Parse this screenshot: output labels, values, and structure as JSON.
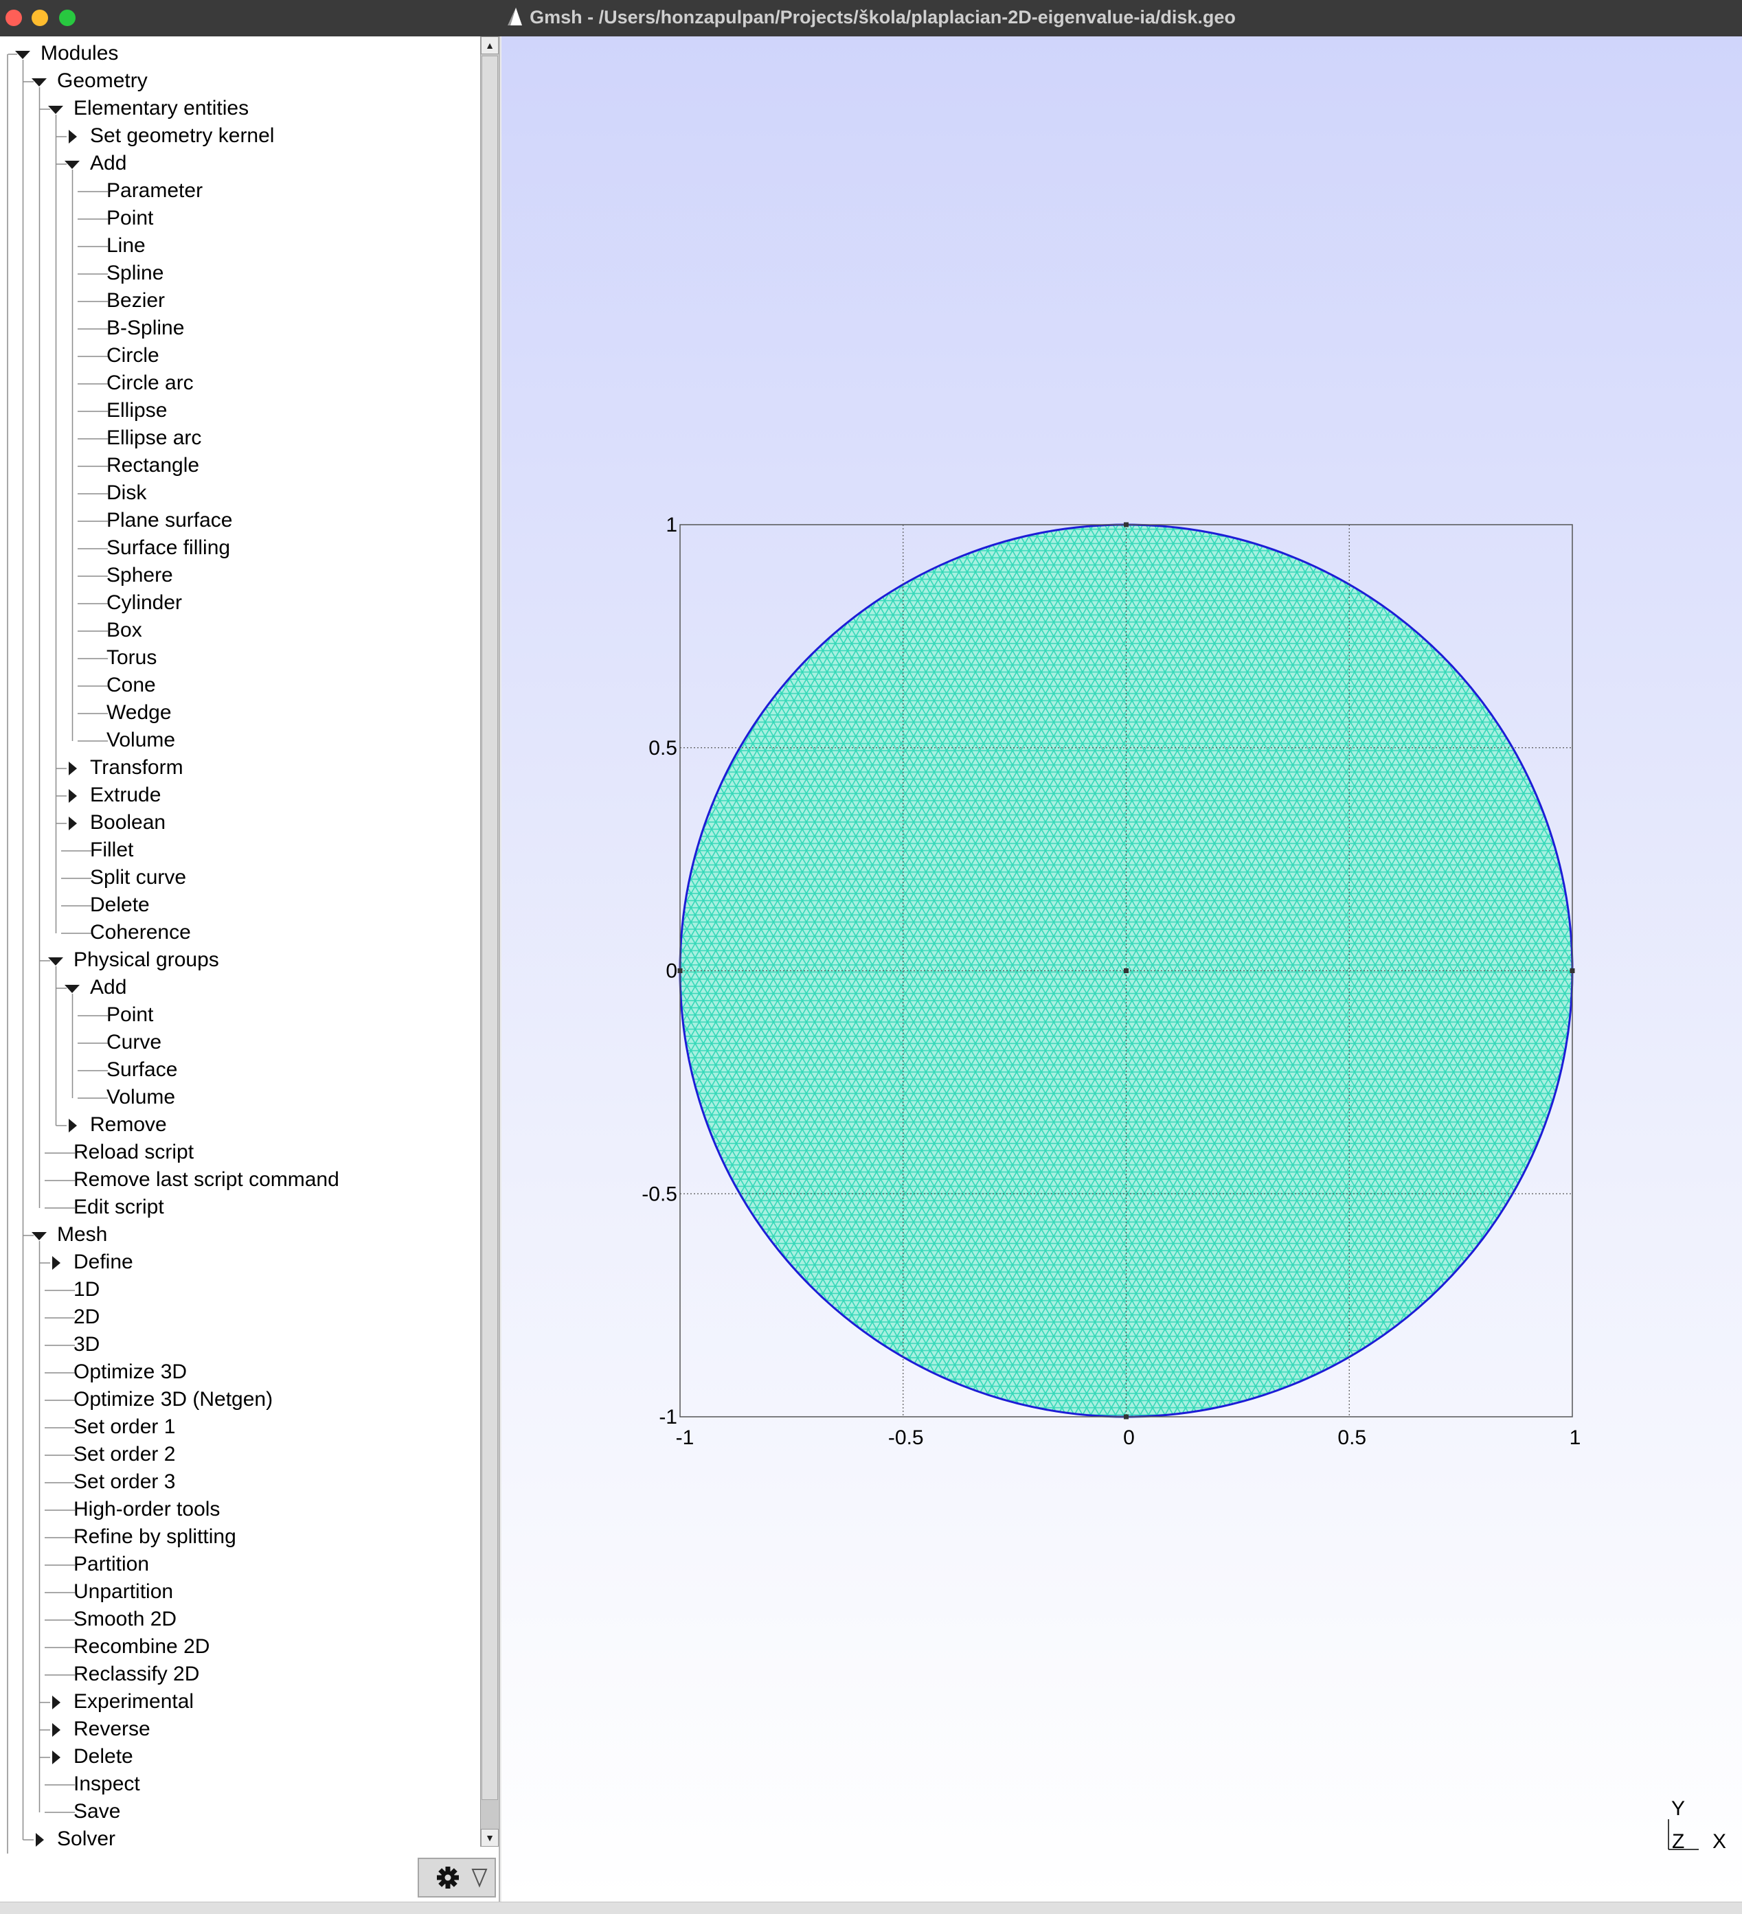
{
  "window": {
    "title": "Gmsh - /Users/honzapulpan/Projects/škola/plaplacian-2D-eigenvalue-ia/disk.geo",
    "traffic_lights": [
      "#ff5f57",
      "#febc2e",
      "#28c840"
    ]
  },
  "tree": [
    {
      "label": "Modules",
      "depth": 0,
      "toggle": "open"
    },
    {
      "label": "Geometry",
      "depth": 1,
      "toggle": "open"
    },
    {
      "label": "Elementary entities",
      "depth": 2,
      "toggle": "open"
    },
    {
      "label": "Set geometry kernel",
      "depth": 3,
      "toggle": "closed"
    },
    {
      "label": "Add",
      "depth": 3,
      "toggle": "open"
    },
    {
      "label": "Parameter",
      "depth": 4,
      "toggle": "leaf"
    },
    {
      "label": "Point",
      "depth": 4,
      "toggle": "leaf"
    },
    {
      "label": "Line",
      "depth": 4,
      "toggle": "leaf"
    },
    {
      "label": "Spline",
      "depth": 4,
      "toggle": "leaf"
    },
    {
      "label": "Bezier",
      "depth": 4,
      "toggle": "leaf"
    },
    {
      "label": "B-Spline",
      "depth": 4,
      "toggle": "leaf"
    },
    {
      "label": "Circle",
      "depth": 4,
      "toggle": "leaf"
    },
    {
      "label": "Circle arc",
      "depth": 4,
      "toggle": "leaf"
    },
    {
      "label": "Ellipse",
      "depth": 4,
      "toggle": "leaf"
    },
    {
      "label": "Ellipse arc",
      "depth": 4,
      "toggle": "leaf"
    },
    {
      "label": "Rectangle",
      "depth": 4,
      "toggle": "leaf"
    },
    {
      "label": "Disk",
      "depth": 4,
      "toggle": "leaf"
    },
    {
      "label": "Plane surface",
      "depth": 4,
      "toggle": "leaf"
    },
    {
      "label": "Surface filling",
      "depth": 4,
      "toggle": "leaf"
    },
    {
      "label": "Sphere",
      "depth": 4,
      "toggle": "leaf"
    },
    {
      "label": "Cylinder",
      "depth": 4,
      "toggle": "leaf"
    },
    {
      "label": "Box",
      "depth": 4,
      "toggle": "leaf"
    },
    {
      "label": "Torus",
      "depth": 4,
      "toggle": "leaf"
    },
    {
      "label": "Cone",
      "depth": 4,
      "toggle": "leaf"
    },
    {
      "label": "Wedge",
      "depth": 4,
      "toggle": "leaf"
    },
    {
      "label": "Volume",
      "depth": 4,
      "toggle": "leaf"
    },
    {
      "label": "Transform",
      "depth": 3,
      "toggle": "closed"
    },
    {
      "label": "Extrude",
      "depth": 3,
      "toggle": "closed"
    },
    {
      "label": "Boolean",
      "depth": 3,
      "toggle": "closed"
    },
    {
      "label": "Fillet",
      "depth": 3,
      "toggle": "leaf"
    },
    {
      "label": "Split curve",
      "depth": 3,
      "toggle": "leaf"
    },
    {
      "label": "Delete",
      "depth": 3,
      "toggle": "leaf"
    },
    {
      "label": "Coherence",
      "depth": 3,
      "toggle": "leaf"
    },
    {
      "label": "Physical groups",
      "depth": 2,
      "toggle": "open"
    },
    {
      "label": "Add",
      "depth": 3,
      "toggle": "open"
    },
    {
      "label": "Point",
      "depth": 4,
      "toggle": "leaf"
    },
    {
      "label": "Curve",
      "depth": 4,
      "toggle": "leaf"
    },
    {
      "label": "Surface",
      "depth": 4,
      "toggle": "leaf"
    },
    {
      "label": "Volume",
      "depth": 4,
      "toggle": "leaf"
    },
    {
      "label": "Remove",
      "depth": 3,
      "toggle": "closed"
    },
    {
      "label": "Reload script",
      "depth": 2,
      "toggle": "leaf"
    },
    {
      "label": "Remove last script command",
      "depth": 2,
      "toggle": "leaf"
    },
    {
      "label": "Edit script",
      "depth": 2,
      "toggle": "leaf"
    },
    {
      "label": "Mesh",
      "depth": 1,
      "toggle": "open"
    },
    {
      "label": "Define",
      "depth": 2,
      "toggle": "closed"
    },
    {
      "label": "1D",
      "depth": 2,
      "toggle": "leaf"
    },
    {
      "label": "2D",
      "depth": 2,
      "toggle": "leaf"
    },
    {
      "label": "3D",
      "depth": 2,
      "toggle": "leaf"
    },
    {
      "label": "Optimize 3D",
      "depth": 2,
      "toggle": "leaf"
    },
    {
      "label": "Optimize 3D (Netgen)",
      "depth": 2,
      "toggle": "leaf"
    },
    {
      "label": "Set order 1",
      "depth": 2,
      "toggle": "leaf"
    },
    {
      "label": "Set order 2",
      "depth": 2,
      "toggle": "leaf"
    },
    {
      "label": "Set order 3",
      "depth": 2,
      "toggle": "leaf"
    },
    {
      "label": "High-order tools",
      "depth": 2,
      "toggle": "leaf"
    },
    {
      "label": "Refine by splitting",
      "depth": 2,
      "toggle": "leaf"
    },
    {
      "label": "Partition",
      "depth": 2,
      "toggle": "leaf"
    },
    {
      "label": "Unpartition",
      "depth": 2,
      "toggle": "leaf"
    },
    {
      "label": "Smooth 2D",
      "depth": 2,
      "toggle": "leaf"
    },
    {
      "label": "Recombine 2D",
      "depth": 2,
      "toggle": "leaf"
    },
    {
      "label": "Reclassify 2D",
      "depth": 2,
      "toggle": "leaf"
    },
    {
      "label": "Experimental",
      "depth": 2,
      "toggle": "closed"
    },
    {
      "label": "Reverse",
      "depth": 2,
      "toggle": "closed"
    },
    {
      "label": "Delete",
      "depth": 2,
      "toggle": "closed"
    },
    {
      "label": "Inspect",
      "depth": 2,
      "toggle": "leaf"
    },
    {
      "label": "Save",
      "depth": 2,
      "toggle": "leaf"
    },
    {
      "label": "Solver",
      "depth": 1,
      "toggle": "closed"
    }
  ],
  "settings_button": {
    "icon": "gear-icon",
    "menu_icon": "triangle-down-icon"
  },
  "viewer": {
    "axes": {
      "x_ticks": [
        "-1",
        "-0.5",
        "0",
        "0.5",
        "1"
      ],
      "y_ticks": [
        "1",
        "0.5",
        "0",
        "-0.5",
        "-1"
      ],
      "x_range": [
        -1,
        1
      ],
      "y_range": [
        -1,
        1
      ],
      "grid": true
    },
    "mesh": {
      "shape": "disk",
      "radius": 1,
      "fill_color": "#a8f0e0",
      "edge_color": "#34d8b8",
      "boundary_color": "#1d1dd6"
    },
    "axes_glyph": {
      "y": "Y",
      "z": "Z",
      "x": "X"
    }
  }
}
